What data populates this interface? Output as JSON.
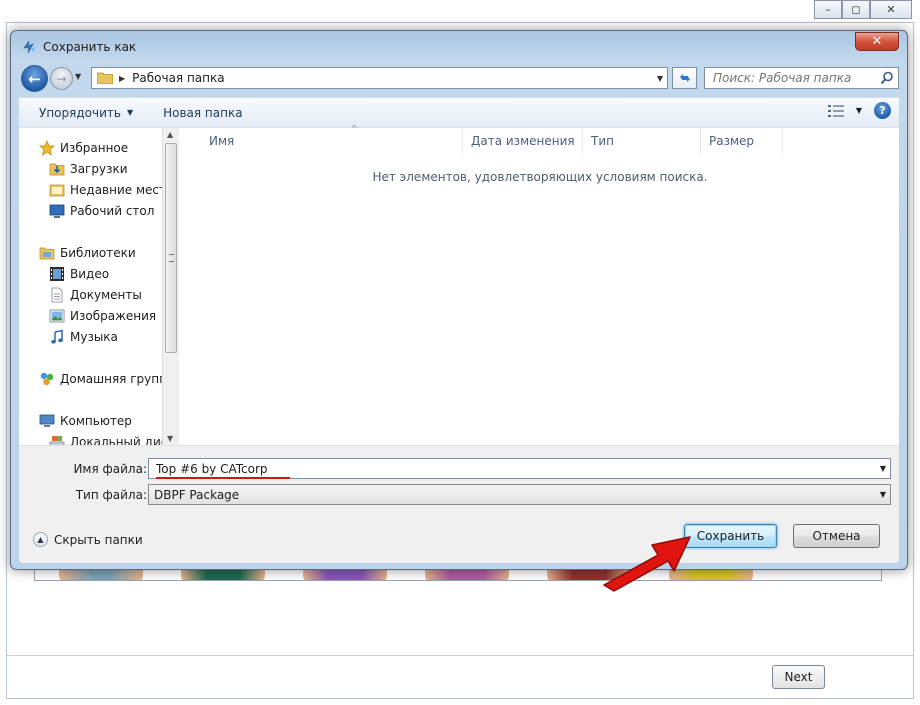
{
  "background_window": {
    "controls": {
      "minimize": "–",
      "maximize": "◻",
      "close": "✕"
    },
    "next_label": "Next"
  },
  "dialog": {
    "title": "Сохранить как",
    "nav": {
      "address": "Рабочая папка",
      "search_placeholder": "Поиск: Рабочая папка"
    },
    "toolbar": {
      "organize_label": "Упорядочить",
      "new_folder_label": "Новая папка"
    },
    "tree": {
      "items": [
        {
          "label": "Избранное",
          "icon": "star-icon"
        },
        {
          "label": "Загрузки",
          "icon": "downloads-folder-icon"
        },
        {
          "label": "Недавние места",
          "icon": "recent-places-icon"
        },
        {
          "label": "Рабочий стол",
          "icon": "desktop-icon"
        },
        {
          "label": "Библиотеки",
          "icon": "libraries-icon"
        },
        {
          "label": "Видео",
          "icon": "video-icon"
        },
        {
          "label": "Документы",
          "icon": "documents-icon"
        },
        {
          "label": "Изображения",
          "icon": "pictures-icon"
        },
        {
          "label": "Музыка",
          "icon": "music-icon"
        },
        {
          "label": "Домашняя группа",
          "icon": "homegroup-icon"
        },
        {
          "label": "Компьютер",
          "icon": "computer-icon"
        },
        {
          "label": "Локальный диск",
          "icon": "local-disk-icon"
        }
      ]
    },
    "columns": [
      "Имя",
      "Дата изменения",
      "Тип",
      "Размер"
    ],
    "empty_message": "Нет элементов, удовлетворяющих условиям поиска.",
    "fields": {
      "filename_label": "Имя файла:",
      "filename_value": "Top #6 by CATcorp",
      "filetype_label": "Тип файла:",
      "filetype_value": "DBPF Package"
    },
    "footer": {
      "hide_folders_label": "Скрыть папки",
      "save_label": "Сохранить",
      "cancel_label": "Отмена"
    }
  },
  "colors": {
    "accent_arrow": "#e0150f",
    "underline": "#d21616",
    "dialog_frame": "#bcd3ea"
  }
}
